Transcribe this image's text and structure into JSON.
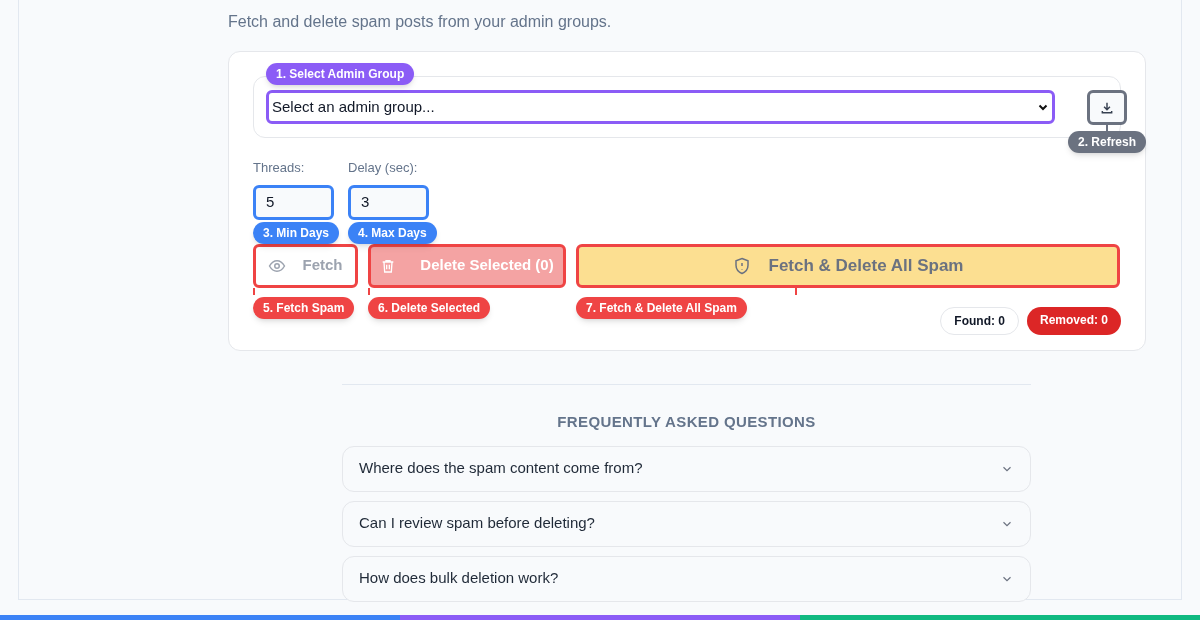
{
  "subtitle": "Fetch and delete spam posts from your admin groups.",
  "group_select": {
    "value": "Select an admin group...",
    "badge": {
      "text": "1. Select Admin Group",
      "color": "#8b5cf6"
    }
  },
  "refresh_button": {
    "badge": {
      "text": "2. Refresh",
      "color": "#6b7280"
    }
  },
  "settings": [
    {
      "label": "Threads:",
      "value": "5",
      "badge": {
        "text": "3. Min Days",
        "color": "#3b82f6"
      }
    },
    {
      "label": "Delay (sec):",
      "value": "3",
      "badge": {
        "text": "4. Max Days",
        "color": "#3b82f6"
      }
    }
  ],
  "actions": [
    {
      "kind": "outline",
      "label": "Fetch",
      "badge": {
        "text": "5. Fetch Spam",
        "color": "#ef4444"
      }
    },
    {
      "kind": "danger",
      "label": "Delete Selected (0)",
      "badge": {
        "text": "6. Delete Selected",
        "color": "#ef4444"
      }
    },
    {
      "kind": "warning",
      "label": "Fetch & Delete All Spam",
      "badge": {
        "text": "7. Fetch & Delete All Spam",
        "color": "#ef4444"
      }
    }
  ],
  "counters": [
    {
      "kind": "neutral",
      "text": "Found: 0"
    },
    {
      "kind": "alert",
      "text": "Removed: 0"
    }
  ],
  "faq": {
    "title": "FREQUENTLY ASKED QUESTIONS",
    "items": [
      {
        "question": "Where does the spam content come from?",
        "expanded": false
      },
      {
        "question": "Can I review spam before deleting?",
        "expanded": false
      },
      {
        "question": "How does bulk deletion work?",
        "expanded": false
      }
    ]
  }
}
